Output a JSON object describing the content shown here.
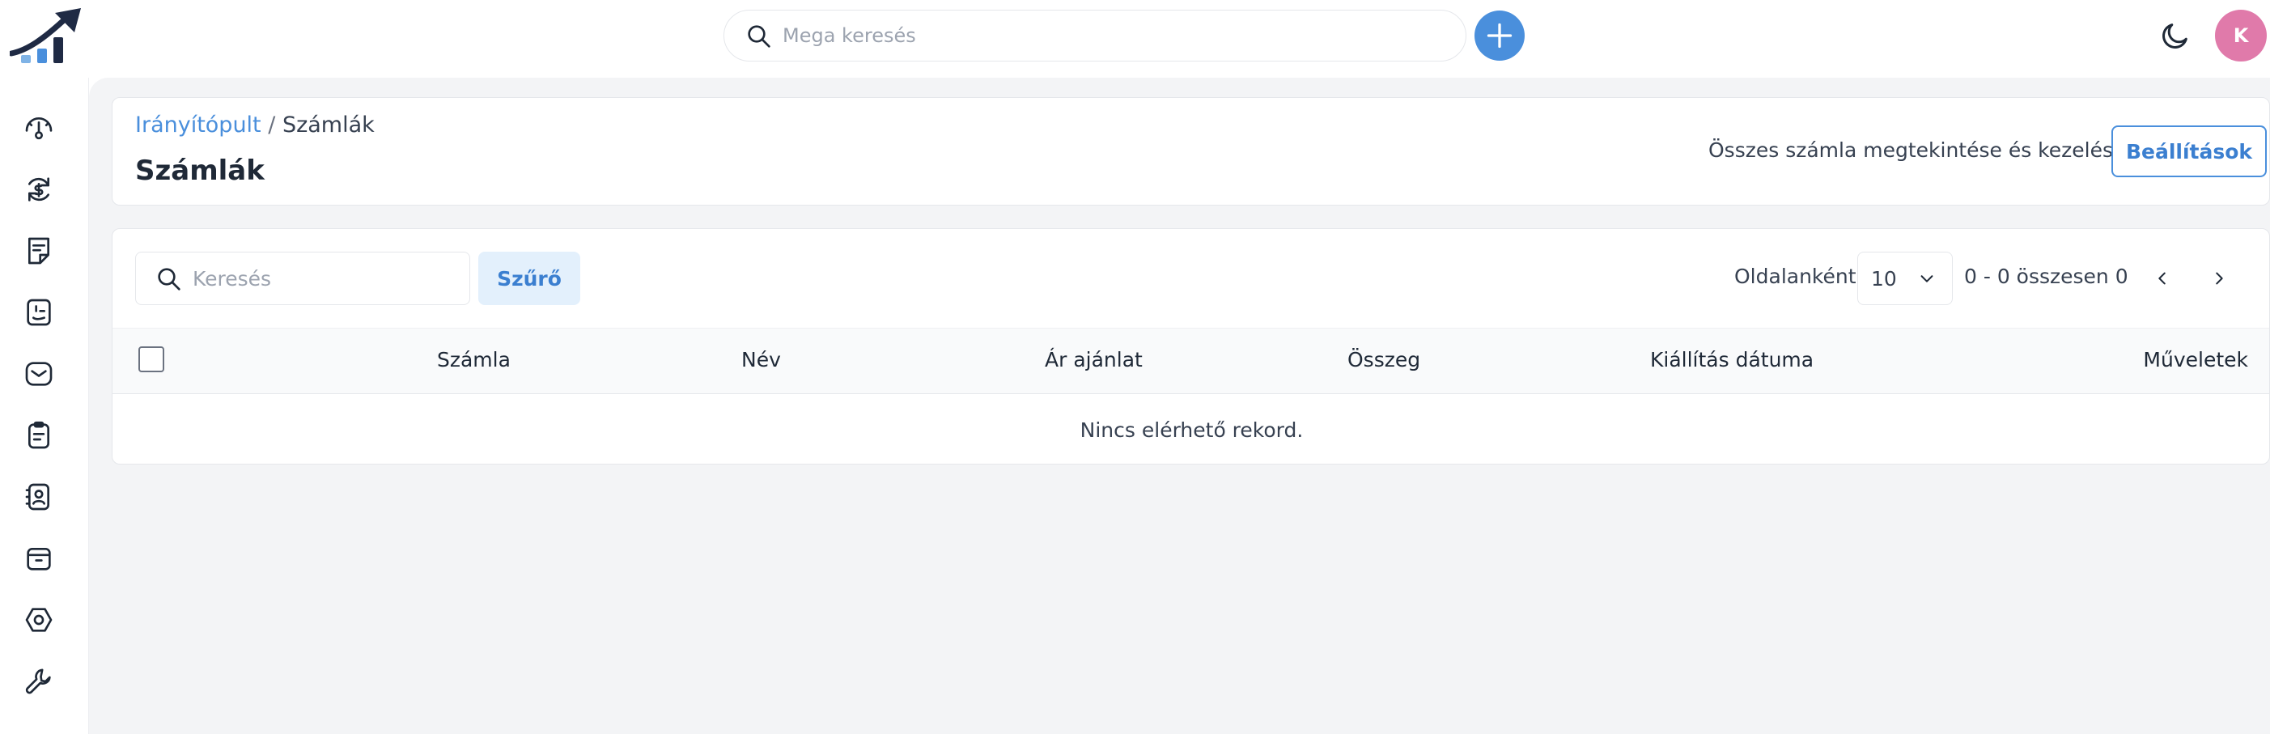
{
  "header": {
    "search_placeholder": "Mega keresés",
    "avatar_initial": "K",
    "accent_color": "#4a8fdc",
    "avatar_color": "#e07aaa"
  },
  "sidebar": {
    "items": [
      {
        "icon": "dashboard-gauge-icon"
      },
      {
        "icon": "finance-refresh-icon"
      },
      {
        "icon": "invoice-document-icon"
      },
      {
        "icon": "expense-note-icon"
      },
      {
        "icon": "inbox-mail-icon"
      },
      {
        "icon": "clipboard-list-icon"
      },
      {
        "icon": "contacts-book-icon"
      },
      {
        "icon": "archive-box-icon"
      },
      {
        "icon": "settings-hexagon-icon"
      },
      {
        "icon": "wrench-tools-icon"
      }
    ]
  },
  "page": {
    "breadcrumb_root": "Irányítópult",
    "breadcrumb_sep": "/",
    "breadcrumb_current": "Számlák",
    "title": "Számlák",
    "description": "Összes számla megtekintése és kezelése",
    "settings_label": "Beállítások"
  },
  "table": {
    "search_placeholder": "Keresés",
    "filter_label": "Szűrő",
    "per_page_label": "Oldalanként",
    "per_page_value": "10",
    "range_text": "0 - 0 összesen 0",
    "columns": [
      "Számla",
      "Név",
      "Ár ajánlat",
      "Összeg",
      "Kiállítás dátuma",
      "Műveletek"
    ],
    "empty_text": "Nincs elérhető rekord."
  }
}
